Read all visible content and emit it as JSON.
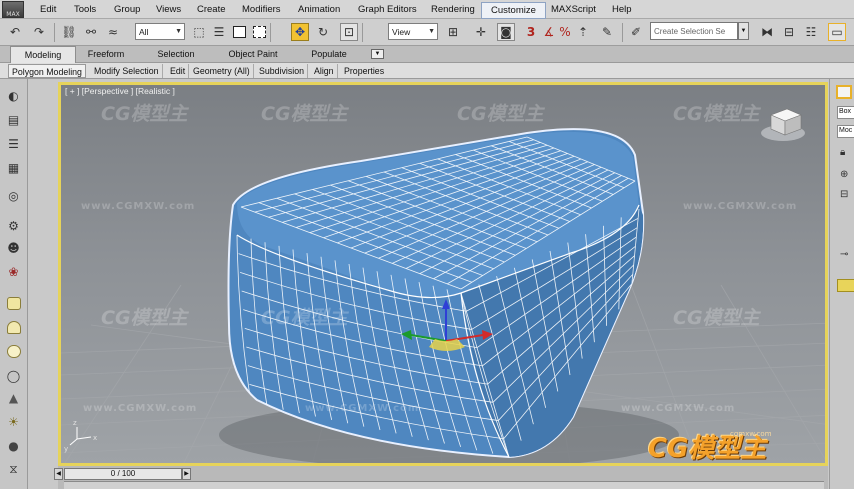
{
  "app": {
    "logo_label": "MAX"
  },
  "menu": {
    "items": [
      "Edit",
      "Tools",
      "Group",
      "Views",
      "Create",
      "Modifiers",
      "Animation",
      "Graph Editors",
      "Rendering",
      "Customize",
      "MAXScript",
      "Help"
    ],
    "active": "Customize"
  },
  "toolbar": {
    "selection_filter": "All",
    "reference_coord": "View",
    "snaps_label": "3",
    "named_selection_placeholder": "Create Selection Se"
  },
  "ribbon": {
    "tabs": [
      "Modeling",
      "Freeform",
      "Selection",
      "Object Paint",
      "Populate"
    ],
    "active_tab": "Modeling",
    "panels": [
      "Polygon Modeling",
      "Modify Selection",
      "Edit",
      "Geometry (All)",
      "Subdivision",
      "Align",
      "Properties"
    ]
  },
  "viewport": {
    "label": "[ + ] [Perspective ] [Realistic ]",
    "frame_color": "#e6d35a",
    "mesh_color": "#4f87c0",
    "wireframe_color": "#ffffff"
  },
  "right_panel": {
    "chips": [
      "Box",
      "Moc"
    ]
  },
  "timeline": {
    "slider_label": "0 / 100",
    "prev_icon": "chevron-left-icon",
    "next_icon": "chevron-right-icon"
  },
  "watermark": {
    "logo": "CG模型主",
    "url": "www.CGMXW.com",
    "corner_url": "cgmxw.com"
  }
}
